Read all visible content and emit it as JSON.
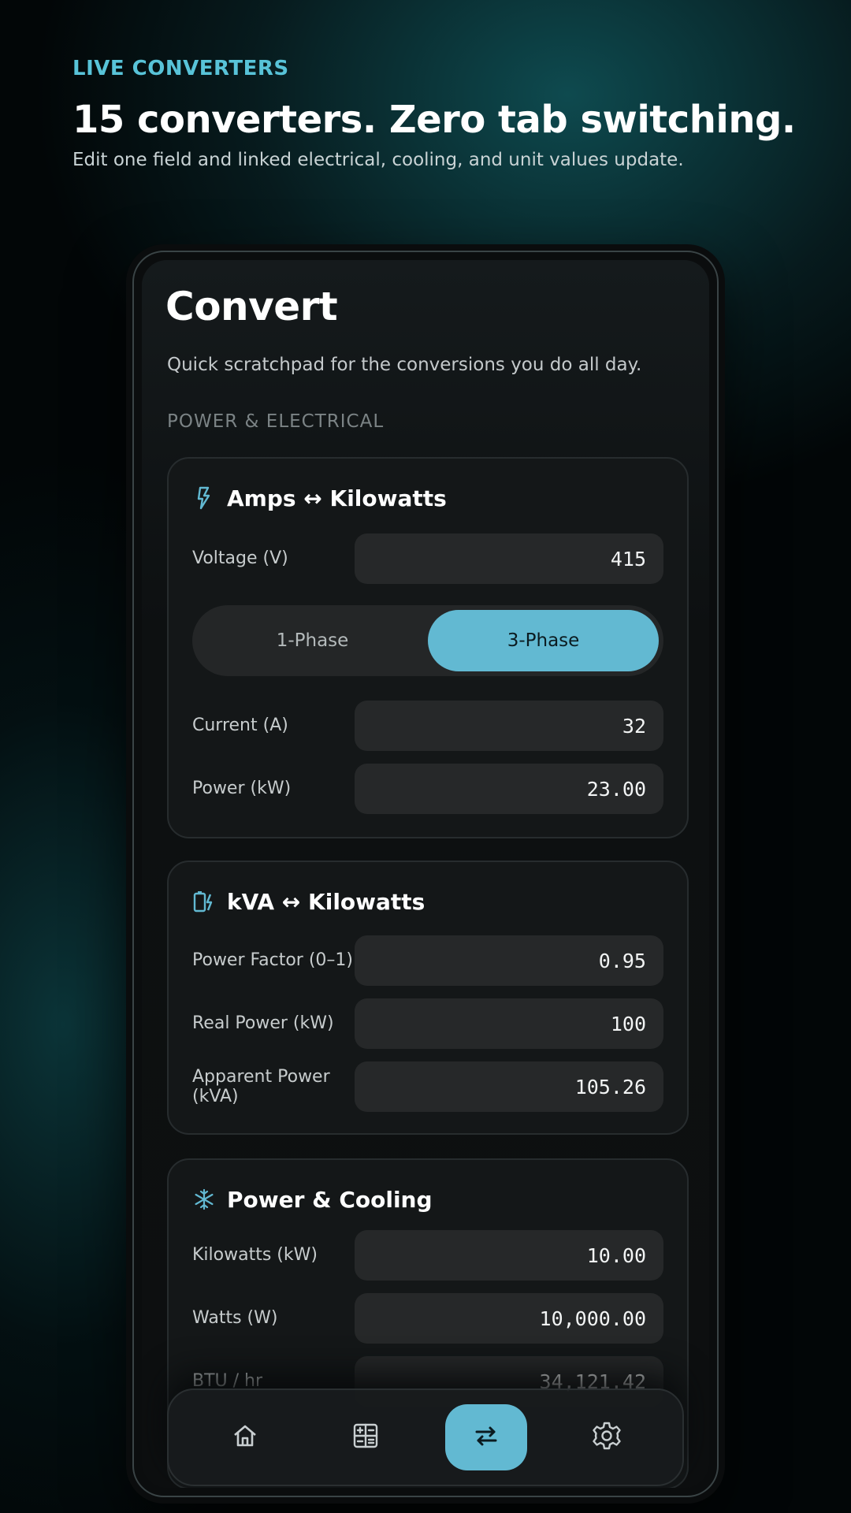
{
  "promo": {
    "eyebrow": "LIVE CONVERTERS",
    "title": "15 converters. Zero tab switching.",
    "subtitle": "Edit one field and linked electrical, cooling, and unit values update."
  },
  "screen": {
    "title": "Convert",
    "subtitle": "Quick scratchpad for the conversions you do all day.",
    "section_label": "POWER & ELECTRICAL"
  },
  "cards": {
    "amps_kw": {
      "icon": "lightning-icon",
      "title": "Amps ↔ Kilowatts",
      "voltage_label": "Voltage (V)",
      "voltage_value": "415",
      "phase_options": [
        "1-Phase",
        "3-Phase"
      ],
      "selected_phase": "3-Phase",
      "current_label": "Current (A)",
      "current_value": "32",
      "power_label": "Power (kW)",
      "power_value": "23.00"
    },
    "kva_kw": {
      "icon": "battery-charging-icon",
      "title": "kVA ↔ Kilowatts",
      "pf_label": "Power Factor (0–1)",
      "pf_value": "0.95",
      "real_label": "Real Power (kW)",
      "real_value": "100",
      "apparent_label": "Apparent Power (kVA)",
      "apparent_value": "105.26"
    },
    "cooling": {
      "icon": "snowflake-icon",
      "title": "Power & Cooling",
      "kw_label": "Kilowatts (kW)",
      "kw_value": "10.00",
      "w_label": "Watts (W)",
      "w_value": "10,000.00",
      "btu_label": "BTU / hr",
      "btu_value": "34,121.42"
    }
  },
  "nav": {
    "items": [
      "home-icon",
      "calculator-icon",
      "swap-arrows-icon",
      "gear-icon"
    ],
    "active": "swap-arrows-icon"
  },
  "colors": {
    "accent": "#62b9d2",
    "eyebrow": "#58c3d8"
  }
}
